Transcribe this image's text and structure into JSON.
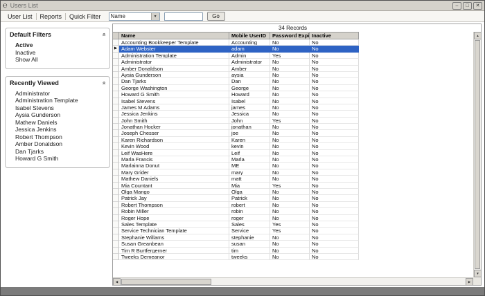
{
  "window": {
    "title": "Users List"
  },
  "icons": {
    "logo": "℮",
    "minimize": "–",
    "maximize": "□",
    "close": "✕",
    "dropdown": "▼",
    "collapse": "»",
    "row-pointer": "▶",
    "scroll-up": "▲",
    "scroll-down": "▼",
    "scroll-left": "◀",
    "scroll-right": "▶"
  },
  "menu": {
    "items": [
      {
        "label": "User List"
      },
      {
        "label": "Reports"
      },
      {
        "label": "Quick Filter"
      }
    ],
    "quick_filter_field": "Name",
    "quick_filter_value": "",
    "go_label": "Go"
  },
  "sidebar": {
    "sections": [
      {
        "title": "Default Filters",
        "active_item": "Active",
        "items": [
          "Active",
          "Inactive",
          "Show All"
        ]
      },
      {
        "title": "Recently Viewed",
        "active_item": "",
        "items": [
          "Administrator",
          "Administration Template",
          "Isabel Stevens",
          "Aysia Gunderson",
          "Mathew Daniels",
          "Jessica Jenkins",
          "Robert Thompson",
          "Amber Donaldson",
          "Dan Tjarks",
          "Howard G Smith"
        ]
      }
    ]
  },
  "table": {
    "record_count": "34 Records",
    "columns": [
      "Name",
      "Mobile UserID",
      "Password Expires",
      "Inactive"
    ],
    "selected_row_index": 1,
    "rows": [
      [
        "Accounting Bookkeeper Template",
        "Accounting",
        "No",
        "No"
      ],
      [
        "Adam Webster",
        "adam",
        "No",
        "No"
      ],
      [
        "Administration Template",
        "Admin",
        "Yes",
        "No"
      ],
      [
        "Administrator",
        "Administrator",
        "No",
        "No"
      ],
      [
        "Amber Donaldson",
        "Amber",
        "No",
        "No"
      ],
      [
        "Aysia Gunderson",
        "aysia",
        "No",
        "No"
      ],
      [
        "Dan Tjarks",
        "Dan",
        "No",
        "No"
      ],
      [
        "George Washington",
        "George",
        "No",
        "No"
      ],
      [
        "Howard G Smith",
        "Howard",
        "No",
        "No"
      ],
      [
        "Isabel Stevens",
        "Isabel",
        "No",
        "No"
      ],
      [
        "James M Adams",
        "james",
        "No",
        "No"
      ],
      [
        "Jessica Jenkins",
        "Jessica",
        "No",
        "No"
      ],
      [
        "John Smith",
        "John",
        "Yes",
        "No"
      ],
      [
        "Jonathan Hocker",
        "jonathan",
        "No",
        "No"
      ],
      [
        "Joseph Chesser",
        "joe",
        "No",
        "No"
      ],
      [
        "Karen Richardson",
        "Karen",
        "No",
        "No"
      ],
      [
        "Kevin Wood",
        "kevin",
        "No",
        "No"
      ],
      [
        "Leif WasHere",
        "Leif",
        "No",
        "No"
      ],
      [
        "Marla Francis",
        "Marla",
        "No",
        "No"
      ],
      [
        "Marlainna Donut",
        "ME",
        "No",
        "No"
      ],
      [
        "Mary Grider",
        "mary",
        "No",
        "No"
      ],
      [
        "Mathew Daniels",
        "matt",
        "No",
        "No"
      ],
      [
        "Mia Countant",
        "Mia",
        "Yes",
        "No"
      ],
      [
        "Olga Mango",
        "Olga",
        "No",
        "No"
      ],
      [
        "Patrick Jay",
        "Patrick",
        "No",
        "No"
      ],
      [
        "Robert Thompson",
        "robert",
        "No",
        "No"
      ],
      [
        "Robin Miller",
        "robin",
        "No",
        "No"
      ],
      [
        "Roger Hope",
        "roger",
        "No",
        "No"
      ],
      [
        "Sales Template",
        "Sales",
        "Yes",
        "No"
      ],
      [
        "Service Technician Template",
        "Service",
        "Yes",
        "No"
      ],
      [
        "Stephanie Willams",
        "stephanie",
        "No",
        "No"
      ],
      [
        "Susan Greanbean",
        "susan",
        "No",
        "No"
      ],
      [
        "Tim R Burtfergerner",
        "tim",
        "No",
        "No"
      ],
      [
        "Tweeks Demeanor",
        "tweeks",
        "No",
        "No"
      ]
    ]
  },
  "colors": {
    "selection": "#2e63c4",
    "header_bg": "#d5d2cb",
    "titlebar_bg": "#d5d2cb",
    "frame": "#7b7b7b"
  }
}
